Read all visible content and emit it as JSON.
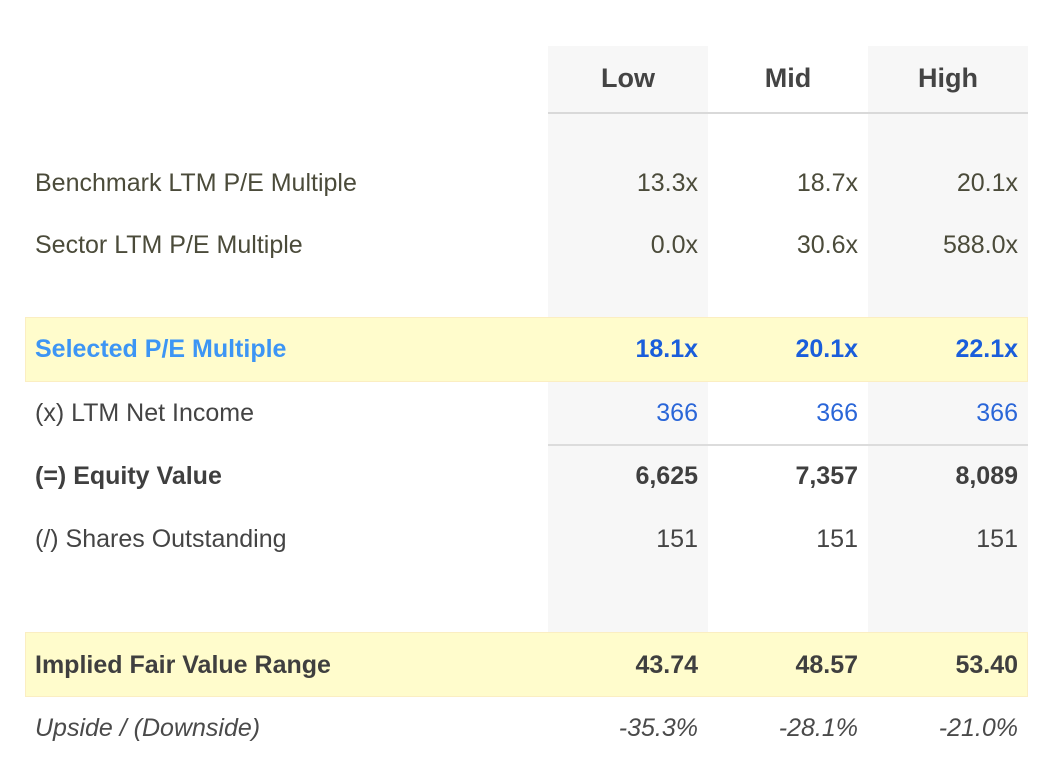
{
  "columns": [
    "Low",
    "Mid",
    "High"
  ],
  "rows": {
    "benchmark": {
      "label": "Benchmark LTM P/E Multiple",
      "values": [
        "13.3x",
        "18.7x",
        "20.1x"
      ]
    },
    "sector": {
      "label": "Sector LTM P/E Multiple",
      "values": [
        "0.0x",
        "30.6x",
        "588.0x"
      ]
    },
    "selected": {
      "label": "Selected P/E Multiple",
      "values": [
        "18.1x",
        "20.1x",
        "22.1x"
      ]
    },
    "net_income": {
      "label": "(x) LTM Net Income",
      "values": [
        "366",
        "366",
        "366"
      ]
    },
    "equity_value": {
      "label": "(=) Equity Value",
      "values": [
        "6,625",
        "7,357",
        "8,089"
      ]
    },
    "shares": {
      "label": "(/) Shares Outstanding",
      "values": [
        "151",
        "151",
        "151"
      ]
    },
    "implied": {
      "label": "Implied Fair Value Range",
      "values": [
        "43.74",
        "48.57",
        "53.40"
      ]
    },
    "upside": {
      "label": "Upside / (Downside)",
      "values": [
        "-35.3%",
        "-28.1%",
        "-21.0%"
      ]
    }
  },
  "colors": {
    "highlight_bg": "#fffccc",
    "column_band": "#f7f7f7",
    "selected_label": "#3d95f4",
    "selected_values": "#1a5edb",
    "link_blue": "#2a66d8"
  }
}
